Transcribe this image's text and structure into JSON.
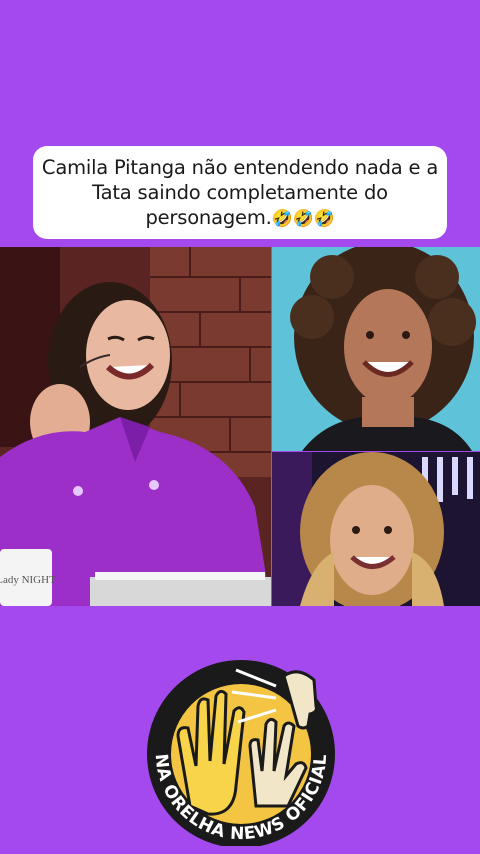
{
  "caption": {
    "text": "Camila Pitanga não entendendo nada e a Tata saindo completamente do personagem.",
    "emoji": "🤣🤣🤣"
  },
  "video": {
    "show_logo_text": "Lady NIGHT"
  },
  "brand": {
    "arc_text": "NA ORELHA NEWS OFICIAL",
    "logo_icon": "whispering-hands-icon"
  },
  "colors": {
    "background": "#a449ee",
    "caption_bg": "#ffffff",
    "logo_ring": "#1a1a1a",
    "logo_inner": "#f4c542"
  }
}
